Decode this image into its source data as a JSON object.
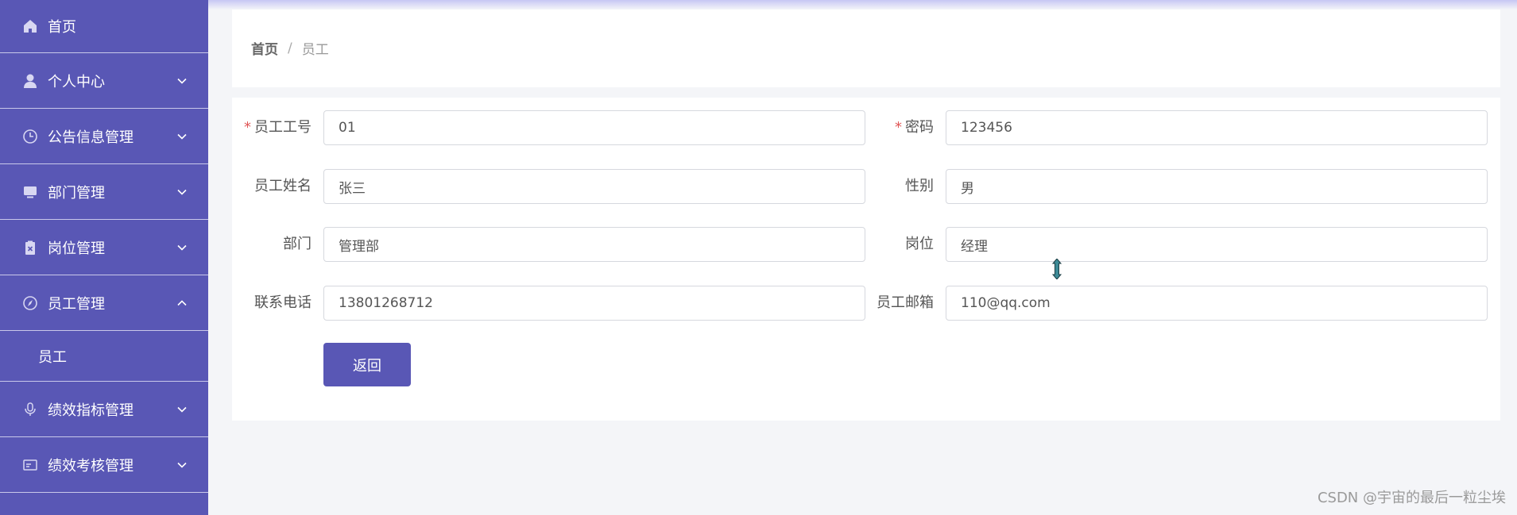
{
  "sidebar": {
    "items": [
      {
        "label": "首页",
        "icon": "home-icon",
        "expandable": false
      },
      {
        "label": "个人中心",
        "icon": "user-icon",
        "expandable": true
      },
      {
        "label": "公告信息管理",
        "icon": "clock-icon",
        "expandable": true
      },
      {
        "label": "部门管理",
        "icon": "monitor-icon",
        "expandable": true
      },
      {
        "label": "岗位管理",
        "icon": "clipboard-icon",
        "expandable": true
      },
      {
        "label": "员工管理",
        "icon": "compass-icon",
        "expandable": true,
        "expanded": true,
        "children": [
          {
            "label": "员工"
          }
        ]
      },
      {
        "label": "绩效指标管理",
        "icon": "microphone-icon",
        "expandable": true
      },
      {
        "label": "绩效考核管理",
        "icon": "card-icon",
        "expandable": true
      }
    ]
  },
  "breadcrumb": {
    "home": "首页",
    "separator": "/",
    "current": "员工"
  },
  "form": {
    "employee_no": {
      "label": "员工工号",
      "required": true,
      "value": "01"
    },
    "password": {
      "label": "密码",
      "required": true,
      "value": "123456"
    },
    "name": {
      "label": "员工姓名",
      "value": "张三"
    },
    "gender": {
      "label": "性别",
      "value": "男"
    },
    "department": {
      "label": "部门",
      "value": "管理部"
    },
    "position": {
      "label": "岗位",
      "value": "经理"
    },
    "phone": {
      "label": "联系电话",
      "value": "13801268712"
    },
    "email": {
      "label": "员工邮箱",
      "value": "110@qq.com"
    },
    "back_label": "返回"
  },
  "watermark": "CSDN @宇宙的最后一粒尘埃",
  "colors": {
    "accent": "#5957b5",
    "required": "#e05656",
    "background": "#f4f5f8"
  }
}
